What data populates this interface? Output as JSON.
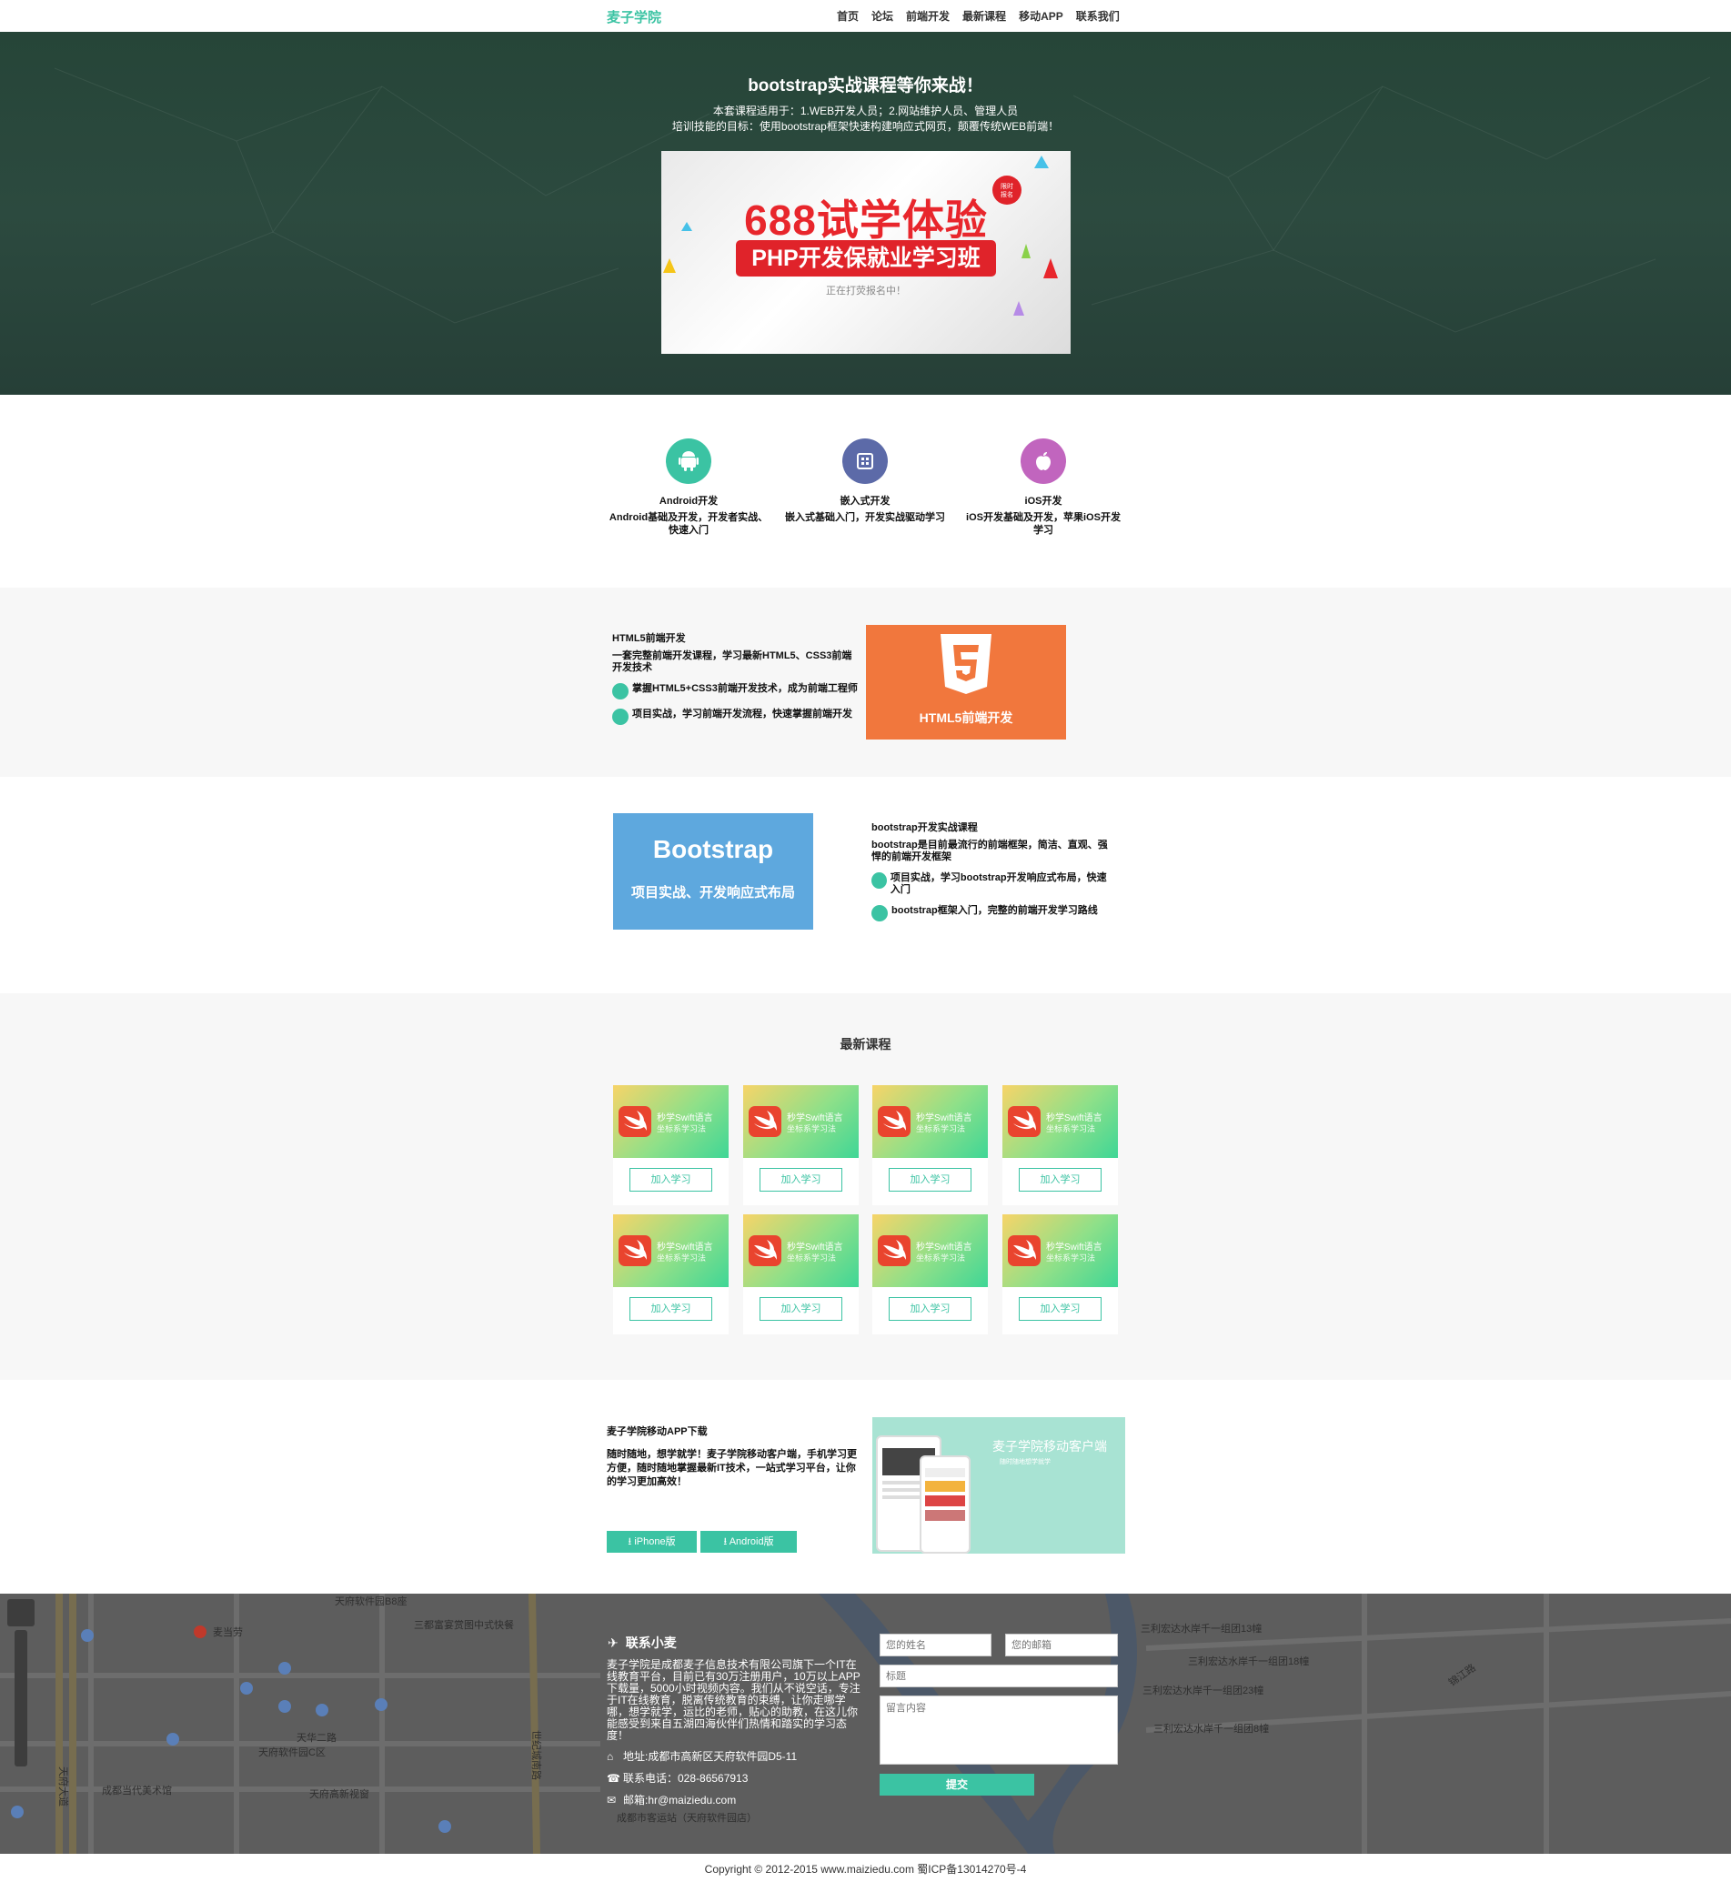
{
  "nav": {
    "brand": "麦子学院",
    "items": [
      "首页",
      "论坛",
      "前端开发",
      "最新课程",
      "移动APP",
      "联系我们"
    ]
  },
  "hero": {
    "title": "bootstrap实战课程等你来战！",
    "line1": "本套课程适用于：1.WEB开发人员；2.网站维护人员、管理人员",
    "line2": "培训技能的目标：使用bootstrap框架快速构建响应式网页，颠覆传统WEB前端！",
    "banner": {
      "big": "688试学体验",
      "red": "PHP开发保就业学习班",
      "small": "正在打荧报名中！",
      "badge_line1": "限时",
      "badge_line2": "报名"
    }
  },
  "features": [
    {
      "icon": "android-icon",
      "color": "#3bc3a3",
      "title": "Android开发",
      "desc": "Android基础及开发，开发者实战、快速入门"
    },
    {
      "icon": "chip-icon",
      "color": "#5c6aa8",
      "title": "嵌入式开发",
      "desc": "嵌入式基础入门，开发实战驱动学习"
    },
    {
      "icon": "apple-icon",
      "color": "#c165be",
      "title": "iOS开发",
      "desc": "iOS开发基础及开发，苹果iOS开发学习"
    }
  ],
  "html5": {
    "heading": "HTML5前端开发",
    "intro": "一套完整前端开发课程，学习最新HTML5、CSS3前端开发技术",
    "point1": "掌握HTML5+CSS3前端开发技术，成为前端工程师",
    "point2": "项目实战，学习前端开发流程，快速掌握前端开发",
    "box_label": "HTML5前端开发"
  },
  "bootstrap": {
    "heading": "bootstrap开发实战课程",
    "intro": "bootstrap是目前最流行的前端框架，简洁、直观、强悍的前端开发框架",
    "point1": "项目实战，学习bootstrap开发响应式布局，快速入门",
    "point2": "bootstrap框架入门，完整的前端开发学习路线",
    "box_title": "Bootstrap",
    "box_sub": "项目实战、开发响应式布局"
  },
  "courses": {
    "title": "最新课程",
    "thumb_line1": "秒学Swift语言",
    "thumb_line2": "坐标系学习法",
    "button": "加入学习",
    "count": 8
  },
  "app": {
    "heading": "麦子学院移动APP下载",
    "desc": "随时随地，想学就学！麦子学院移动客户端，手机学习更方便，随时随地掌握最新IT技术，一站式学习平台，让你的学习更加高效！",
    "iphone_btn": "iPhone版",
    "android_btn": "Android版",
    "img_title": "麦子学院移动客户端",
    "img_sub": "随时随地想学就学"
  },
  "contact": {
    "title": "联系小麦",
    "desc": "麦子学院是成都麦子信息技术有限公司旗下一个IT在线教育平台，目前已有30万注册用户，10万以上APP下载量，5000小时视频内容。我们从不说空话，专注于IT在线教育，脱离传统教育的束缚，让你走哪学哪，想学就学，运比的老师，贴心的助教，在这儿你能感受到来自五湖四海伙伴们热情和踏实的学习态度！",
    "address": "地址:成都市高新区天府软件园D5-11",
    "phone": "联系电话：028-86567913",
    "email": "邮箱:hr@maiziedu.com",
    "name_placeholder": "您的姓名",
    "email_placeholder": "您的邮箱",
    "subject_placeholder": "标题",
    "message_placeholder": "留言内容",
    "submit": "提交",
    "map_labels": [
      "天府软件园B8座",
      "三都富宴赏图中式快餐",
      "麦当劳",
      "天华二路",
      "天府软件园C区",
      "成都当代美术馆",
      "天府高新视窗",
      "成都市客运站（天府软件园店）",
      "天府大道",
      "世纪城南路",
      "锦江路",
      "三利宏达水岸千一组团13幢",
      "三利宏达水岸千一组团18幢",
      "三利宏达水岸千一组团23幢",
      "三利宏达水岸千一组团8幢"
    ]
  },
  "copyright": "Copyright © 2012-2015  www.maiziedu.com  蜀ICP备13014270号-4",
  "colors": {
    "accent": "#3bc3a3",
    "hero_bg": "#2a463b",
    "html5_orange": "#f1773d",
    "bootstrap_blue": "#5ea8de",
    "footer_bg": "#5d5d5d"
  }
}
